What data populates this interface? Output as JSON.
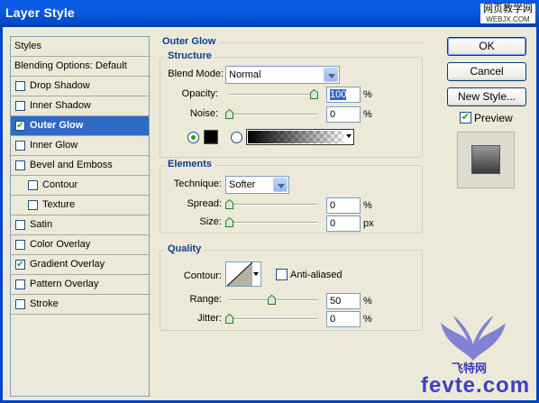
{
  "window": {
    "title": "Layer Style"
  },
  "watermark_top": {
    "line1": "网页教学网",
    "line2": "WEBJX.COM"
  },
  "styles_panel": {
    "items": [
      {
        "label": "Styles",
        "type": "header"
      },
      {
        "label": "Blending Options: Default",
        "type": "header"
      },
      {
        "label": "Drop Shadow",
        "checked": false
      },
      {
        "label": "Inner Shadow",
        "checked": false
      },
      {
        "label": "Outer Glow",
        "checked": true,
        "selected": true
      },
      {
        "label": "Inner Glow",
        "checked": false
      },
      {
        "label": "Bevel and Emboss",
        "checked": false
      },
      {
        "label": "Contour",
        "checked": false,
        "indent": true
      },
      {
        "label": "Texture",
        "checked": false,
        "indent": true
      },
      {
        "label": "Satin",
        "checked": false
      },
      {
        "label": "Color Overlay",
        "checked": false
      },
      {
        "label": "Gradient Overlay",
        "checked": true
      },
      {
        "label": "Pattern Overlay",
        "checked": false
      },
      {
        "label": "Stroke",
        "checked": false
      }
    ]
  },
  "outer_glow": {
    "section_title": "Outer Glow",
    "structure": {
      "title": "Structure",
      "blend_mode_label": "Blend Mode:",
      "blend_mode_value": "Normal",
      "opacity_label": "Opacity:",
      "opacity_value": "100",
      "opacity_level": 1.0,
      "noise_label": "Noise:",
      "noise_value": "0",
      "noise_level": 0,
      "percent": "%",
      "glow_color": "#000000"
    },
    "elements": {
      "title": "Elements",
      "technique_label": "Technique:",
      "technique_value": "Softer",
      "spread_label": "Spread:",
      "spread_value": "0",
      "spread_level": 0,
      "size_label": "Size:",
      "size_value": "0",
      "size_level": 0,
      "percent": "%",
      "px": "px"
    },
    "quality": {
      "title": "Quality",
      "contour_label": "Contour:",
      "anti_aliased_label": "Anti-aliased",
      "anti_aliased_checked": false,
      "range_label": "Range:",
      "range_value": "50",
      "range_level": 0.5,
      "jitter_label": "Jitter:",
      "jitter_value": "0",
      "jitter_level": 0,
      "percent": "%"
    }
  },
  "actions": {
    "ok": "OK",
    "cancel": "Cancel",
    "new_style": "New Style...",
    "preview_label": "Preview",
    "preview_checked": true
  },
  "watermark_bottom": {
    "brand": "飞特网",
    "domain": "fevte.com"
  },
  "colors": {
    "accent": "#316ac5",
    "title_bar": "#0a5ae6",
    "section_title": "#0a3f97",
    "check": "#21a121"
  }
}
